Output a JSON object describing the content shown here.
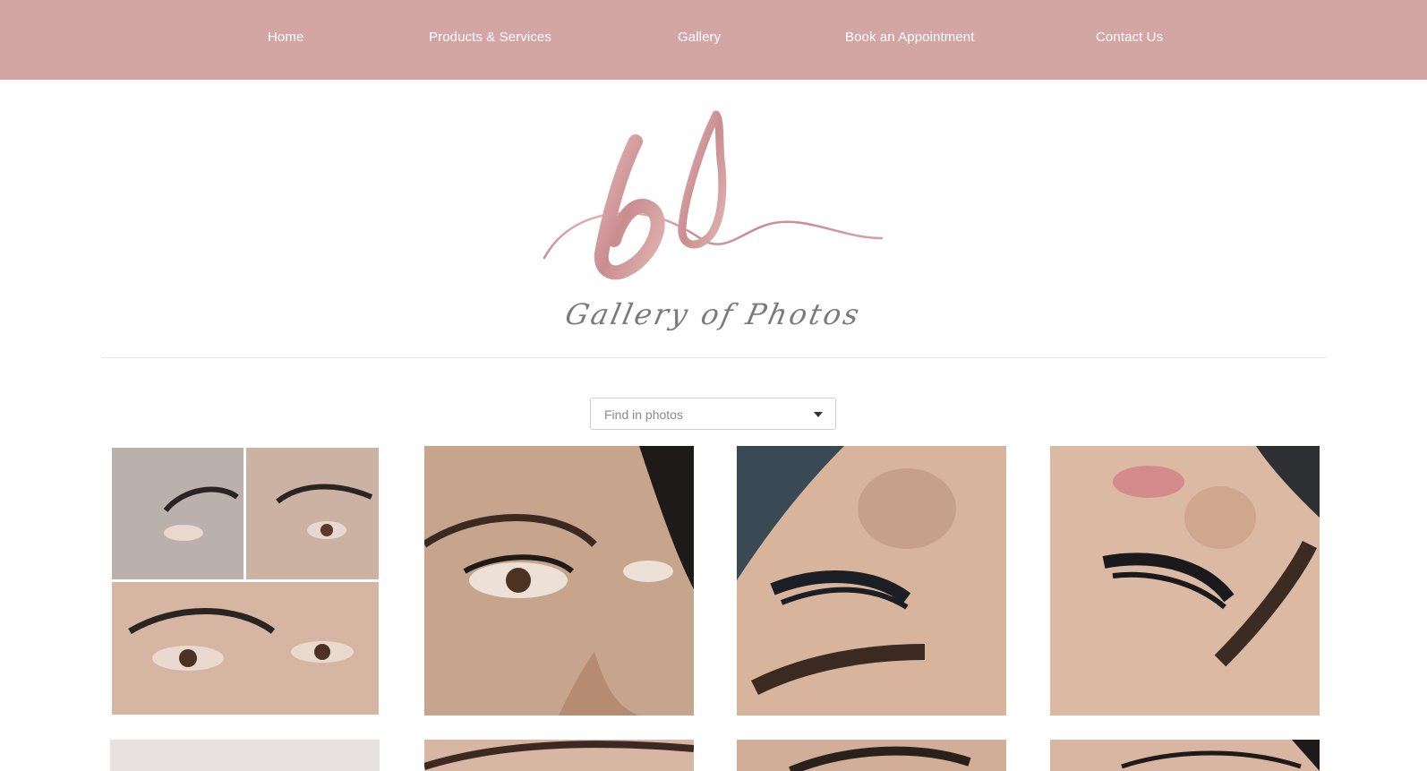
{
  "nav": {
    "items": [
      {
        "label": "Home"
      },
      {
        "label": "Products  &  Services"
      },
      {
        "label": "Gallery"
      },
      {
        "label": "Book an Appointment"
      },
      {
        "label": "Contact Us"
      }
    ]
  },
  "brand": {
    "monogram": "bl",
    "color": "#d4a0a2"
  },
  "page": {
    "title": "Gallery of Photos"
  },
  "search": {
    "placeholder": "Find in photos"
  },
  "colors": {
    "nav_background": "#d4a5a5",
    "accent": "#c9898c"
  },
  "gallery": {
    "rows_visible": 2,
    "photos": [
      {
        "name": "collage-lash-extensions"
      },
      {
        "name": "eye-lash-closeup-side"
      },
      {
        "name": "closed-eye-lashes-top-view"
      },
      {
        "name": "closed-eye-lashes-side-view"
      },
      {
        "name": "photo-row2-1"
      },
      {
        "name": "photo-row2-2"
      },
      {
        "name": "photo-row2-3"
      },
      {
        "name": "photo-row2-4"
      }
    ]
  }
}
